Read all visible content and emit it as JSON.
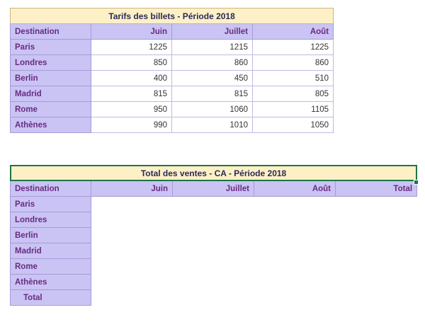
{
  "table1": {
    "title": "Tarifs des billets - Période 2018",
    "headers": [
      "Destination",
      "Juin",
      "Juillet",
      "Août"
    ],
    "rows": [
      {
        "destination": "Paris",
        "juin": "1225",
        "juillet": "1215",
        "aout": "1225"
      },
      {
        "destination": "Londres",
        "juin": "850",
        "juillet": "860",
        "aout": "860"
      },
      {
        "destination": "Berlin",
        "juin": "400",
        "juillet": "450",
        "aout": "510"
      },
      {
        "destination": "Madrid",
        "juin": "815",
        "juillet": "815",
        "aout": "805"
      },
      {
        "destination": "Rome",
        "juin": "950",
        "juillet": "1060",
        "aout": "1105"
      },
      {
        "destination": "Athènes",
        "juin": "990",
        "juillet": "1010",
        "aout": "1050"
      }
    ]
  },
  "table2": {
    "title": "Total des ventes - CA - Période 2018",
    "headers": [
      "Destination",
      "Juin",
      "Juillet",
      "Août",
      "Total"
    ],
    "rows": [
      "Paris",
      "Londres",
      "Berlin",
      "Madrid",
      "Rome",
      "Athènes",
      "Total"
    ]
  },
  "colors": {
    "title_bg": "#fdf0c6",
    "header_bg": "#c9c4f4",
    "header_text": "#6a2a82",
    "selection": "#217346"
  }
}
